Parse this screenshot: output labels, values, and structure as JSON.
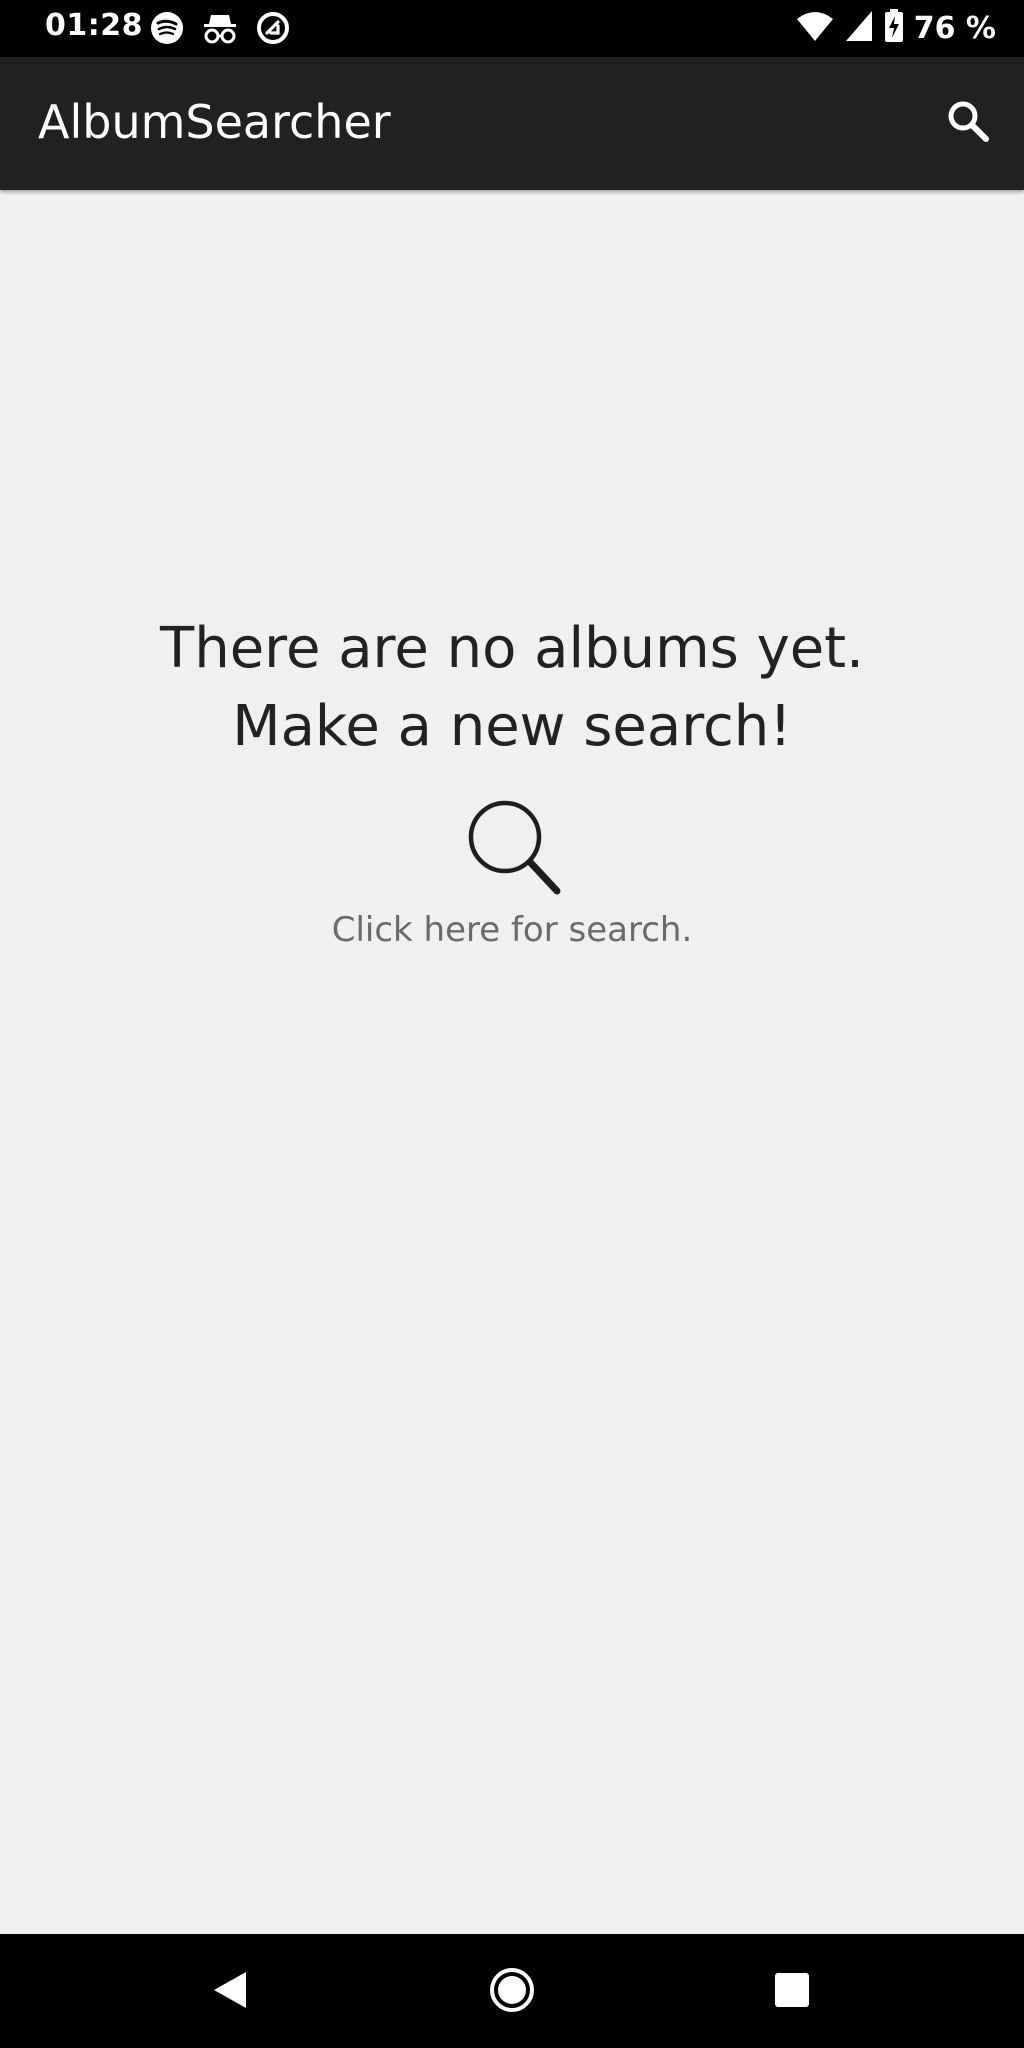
{
  "status_bar": {
    "time": "01:28",
    "battery": "76 %",
    "icons_left": [
      "spotify-icon",
      "incognito-icon",
      "vpn-icon"
    ],
    "icons_right": [
      "wifi-icon",
      "signal-icon",
      "battery-charging-icon"
    ]
  },
  "app_bar": {
    "title": "AlbumSearcher",
    "search_icon": "search-icon"
  },
  "empty_state": {
    "line1": "There are no albums yet.",
    "line2": "Make a new search!",
    "icon": "magnifier-icon",
    "hint": "Click here for search."
  },
  "nav_bar": {
    "buttons": [
      "back-icon",
      "home-icon",
      "recents-icon"
    ]
  },
  "colors": {
    "status_bar_bg": "#000000",
    "app_bar_bg": "#212121",
    "page_bg": "#f0f0f0",
    "text_primary": "#222222",
    "text_secondary": "#6a6a6a"
  }
}
